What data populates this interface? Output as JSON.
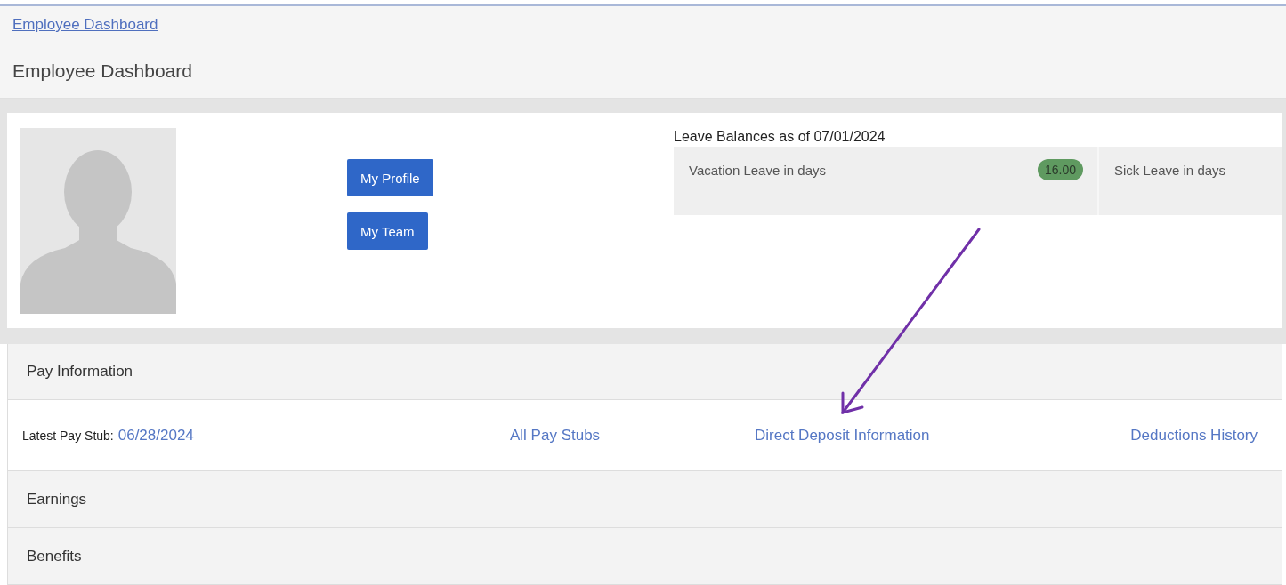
{
  "breadcrumb": {
    "label": "Employee Dashboard"
  },
  "title": "Employee Dashboard",
  "profile": {
    "buttons": [
      "My Profile",
      "My Team"
    ]
  },
  "leave_balances": {
    "heading": "Leave Balances as of 07/01/2024",
    "items": [
      {
        "label": "Vacation Leave in days",
        "value": "16.00"
      },
      {
        "label": "Sick Leave in days"
      }
    ]
  },
  "pay_information": {
    "title": "Pay Information",
    "latest_pay_stub": {
      "label": "Latest Pay Stub:",
      "date": "06/28/2024"
    },
    "links": [
      "All Pay Stubs",
      "Direct Deposit Information",
      "Deductions History"
    ]
  },
  "sections": [
    "Earnings",
    "Benefits"
  ]
}
